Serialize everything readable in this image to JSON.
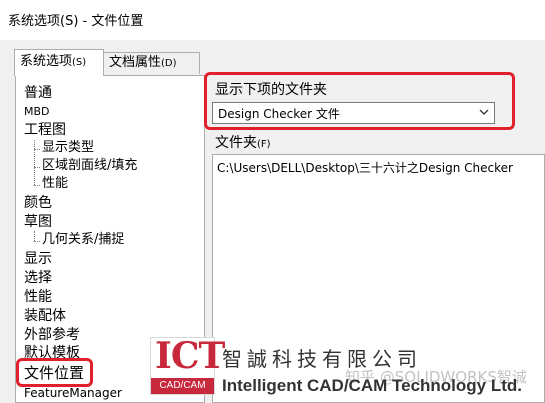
{
  "window": {
    "title": "系统选项(S) - 文件位置"
  },
  "tabs": [
    {
      "label": "系统选项",
      "hotkey": "(S)",
      "active": true
    },
    {
      "label": "文档属性",
      "hotkey": "(D)",
      "active": false
    }
  ],
  "tree": {
    "items": [
      {
        "label": "普通"
      },
      {
        "label": "MBD"
      },
      {
        "label": "工程图"
      },
      {
        "label": "显示类型"
      },
      {
        "label": "区域剖面线/填充"
      },
      {
        "label": "性能"
      },
      {
        "label": "颜色"
      },
      {
        "label": "草图"
      },
      {
        "label": "几何关系/捕捉"
      },
      {
        "label": "显示"
      },
      {
        "label": "选择"
      },
      {
        "label": "性能"
      },
      {
        "label": "装配体"
      },
      {
        "label": "外部参考"
      },
      {
        "label": "默认模板"
      },
      {
        "label": "文件位置",
        "selected": true
      },
      {
        "label": "FeatureManager"
      }
    ]
  },
  "show_folders_for": {
    "label": "显示下项的文件夹",
    "selected_value": "Design Checker 文件"
  },
  "folders": {
    "label": "文件夹",
    "hotkey": "(F)",
    "rows": [
      "C:\\Users\\DELL\\Desktop\\三十六计之Design Checker"
    ]
  },
  "overlay": {
    "logo_text": "ICT",
    "logo_sub": "CAD/CAM",
    "company_cn": "智誠科技有限公司",
    "company_en": "Intelligent CAD/CAM Technology Ltd.",
    "watermark": "知乎 @SOLIDWORKS智诚"
  },
  "colors": {
    "highlight_border": "#e0202a",
    "logo_red": "#c8283c"
  }
}
